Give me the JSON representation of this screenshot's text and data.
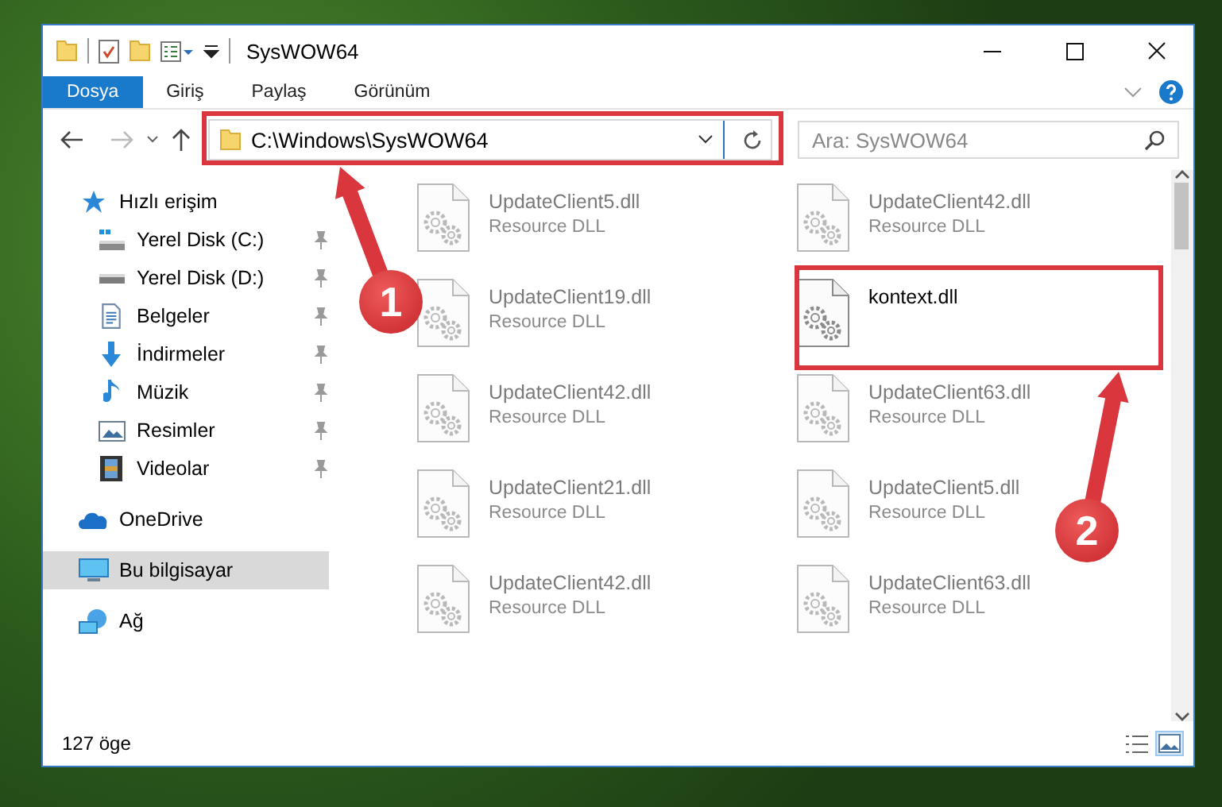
{
  "window": {
    "title": "SysWOW64"
  },
  "ribbon_tabs": [
    {
      "label": "Dosya",
      "selected": true
    },
    {
      "label": "Giriş",
      "selected": false
    },
    {
      "label": "Paylaş",
      "selected": false
    },
    {
      "label": "Görünüm",
      "selected": false
    }
  ],
  "address_bar": {
    "path": "C:\\Windows\\SysWOW64"
  },
  "search": {
    "placeholder": "Ara: SysWOW64"
  },
  "sidebar": {
    "items": [
      {
        "label": "Hızlı erişim",
        "selected": false,
        "children": [
          {
            "label": "Yerel Disk (C:)",
            "pinned": true,
            "selected": false
          },
          {
            "label": "Yerel Disk (D:)",
            "pinned": true,
            "selected": false
          },
          {
            "label": "Belgeler",
            "pinned": true,
            "selected": false
          },
          {
            "label": "İndirmeler",
            "pinned": true,
            "selected": false
          },
          {
            "label": "Müzik",
            "pinned": true,
            "selected": false
          },
          {
            "label": "Resimler",
            "pinned": true,
            "selected": false
          },
          {
            "label": "Videolar",
            "pinned": true,
            "selected": false
          }
        ]
      },
      {
        "label": "OneDrive",
        "selected": false
      },
      {
        "label": "Bu bilgisayar",
        "selected": true
      },
      {
        "label": "Ağ",
        "selected": false
      }
    ]
  },
  "files": [
    {
      "name": "UpdateClient5.dll",
      "type": "Resource DLL",
      "faded": true
    },
    {
      "name": "UpdateClient42.dll",
      "type": "Resource DLL",
      "faded": true
    },
    {
      "name": "UpdateClient19.dll",
      "type": "Resource DLL",
      "faded": true
    },
    {
      "name": "kontext.dll",
      "faded": false
    },
    {
      "name": "UpdateClient42.dll",
      "type": "Resource DLL",
      "faded": true
    },
    {
      "name": "UpdateClient63.dll",
      "type": "Resource DLL",
      "faded": true
    },
    {
      "name": "UpdateClient21.dll",
      "type": "Resource DLL",
      "faded": true
    },
    {
      "name": "UpdateClient5.dll",
      "type": "Resource DLL",
      "faded": true
    },
    {
      "name": "UpdateClient42.dll",
      "type": "Resource DLL",
      "faded": true
    },
    {
      "name": "UpdateClient63.dll",
      "type": "Resource DLL",
      "faded": true
    }
  ],
  "status_bar": {
    "item_count": "127 öge"
  },
  "annotations": [
    {
      "label": "1"
    },
    {
      "label": "2"
    }
  ]
}
